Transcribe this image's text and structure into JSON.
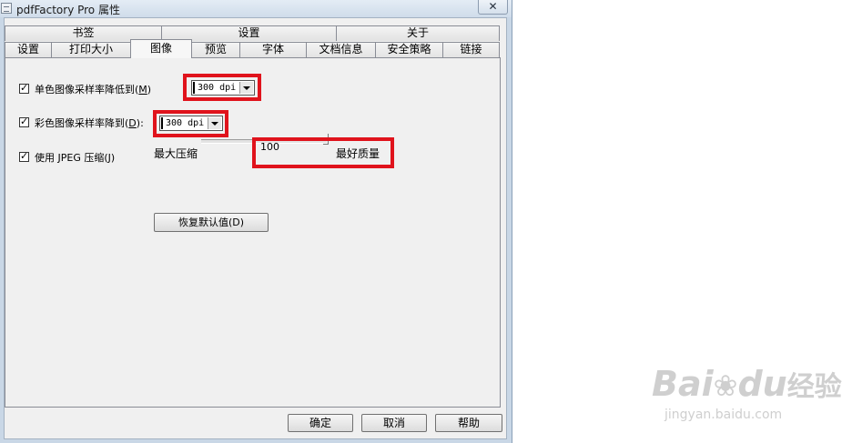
{
  "window": {
    "title": "pdfFactory Pro 属性",
    "close_glyph": "✕"
  },
  "tabs_back_row": [
    {
      "label": "书签"
    },
    {
      "label": "设置"
    },
    {
      "label": "关于"
    }
  ],
  "tabs_front_row": [
    {
      "label": "设置"
    },
    {
      "label": "打印大小"
    },
    {
      "label": "图像",
      "active": true
    },
    {
      "label": "预览"
    },
    {
      "label": "字体"
    },
    {
      "label": "文档信息"
    },
    {
      "label": "安全策略"
    },
    {
      "label": "链接"
    }
  ],
  "image_page": {
    "mono": {
      "checked": true,
      "label": "单色图像采样率降低到(",
      "hotkey": "M",
      "label_suffix": ")",
      "value": "300 dpi"
    },
    "color": {
      "checked": true,
      "label": "彩色图像采样率降到(",
      "hotkey": "D",
      "label_suffix": "):",
      "value": "300 dpi"
    },
    "jpeg": {
      "checked": true,
      "label": "使用 JPEG 压缩(J)",
      "min_label": "最大压缩",
      "max_label": "最好质量",
      "value": "100"
    },
    "restore_button": "恢复默认值(D)"
  },
  "buttons": {
    "ok": "确定",
    "cancel": "取消",
    "help": "帮助"
  },
  "colors": {
    "highlight": "#e0131c"
  },
  "watermark": {
    "brand_latin": "Bai",
    "brand_du": "du",
    "brand_cn": "经验",
    "url": "jingyan.baidu.com"
  }
}
